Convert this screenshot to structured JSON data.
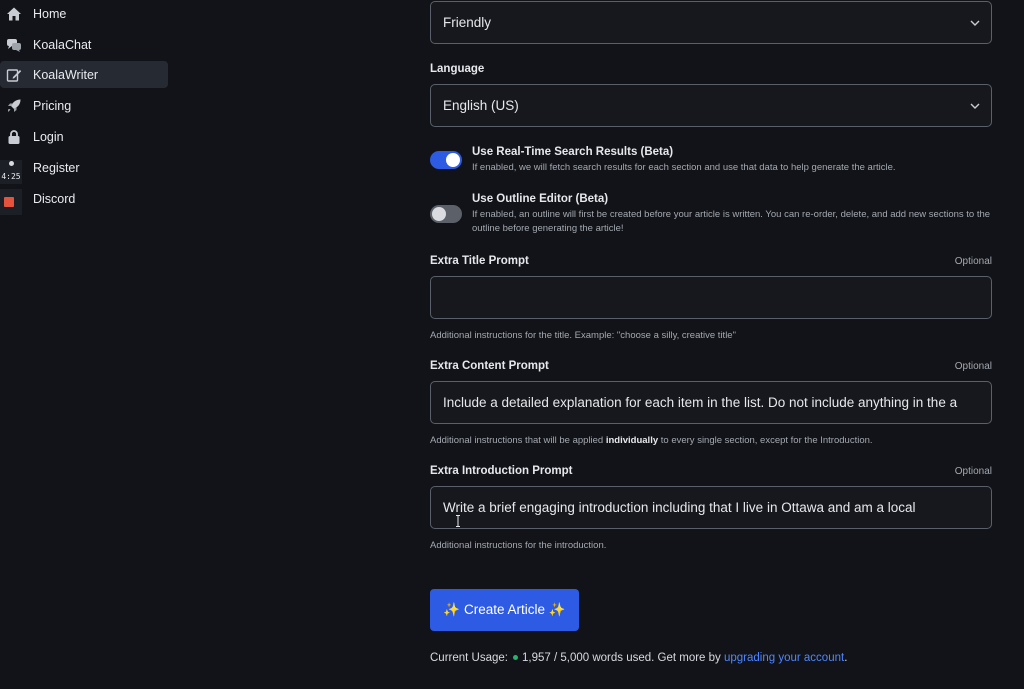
{
  "sidebar": {
    "items": [
      {
        "label": "Home",
        "icon": "home-icon"
      },
      {
        "label": "KoalaChat",
        "icon": "chat-icon"
      },
      {
        "label": "KoalaWriter",
        "icon": "edit-icon",
        "active": true
      },
      {
        "label": "Pricing",
        "icon": "rocket-icon"
      },
      {
        "label": "Login",
        "icon": "lock-icon"
      },
      {
        "label": "Register",
        "icon": "user-icon"
      },
      {
        "label": "Discord",
        "icon": "discord-icon"
      }
    ],
    "clock_text": "4:25"
  },
  "form": {
    "tone_value": "Friendly",
    "language_label": "Language",
    "language_value": "English (US)",
    "realtime": {
      "title": "Use Real-Time Search Results (Beta)",
      "desc": "If enabled, we will fetch search results for each section and use that data to help generate the article.",
      "enabled": true
    },
    "outline": {
      "title": "Use Outline Editor (Beta)",
      "desc": "If enabled, an outline will first be created before your article is written. You can re-order, delete, and add new sections to the outline before generating the article!",
      "enabled": false
    },
    "optional_label": "Optional",
    "extra_title": {
      "label": "Extra Title Prompt",
      "value": "",
      "help": "Additional instructions for the title. Example: \"choose a silly, creative title\""
    },
    "extra_content": {
      "label": "Extra Content Prompt",
      "value": "Include a detailed explanation for each item in the list. Do not include anything in the a",
      "help_pre": "Additional instructions that will be applied ",
      "help_bold": "individually",
      "help_post": " to every single section, except for the Introduction."
    },
    "extra_intro": {
      "label": "Extra Introduction Prompt",
      "value": "Write a brief engaging introduction including that I live in Ottawa and am a local",
      "help": "Additional instructions for the introduction."
    },
    "create_button": "✨ Create Article ✨"
  },
  "usage": {
    "prefix": "Current Usage:",
    "count": "1,957 / 5,000 words used. Get more by",
    "link": "upgrading your account",
    "suffix": "."
  },
  "colors": {
    "background": "#111318",
    "accent": "#2d5be3",
    "link": "#4f86ff",
    "active_nav": "#262a33"
  }
}
